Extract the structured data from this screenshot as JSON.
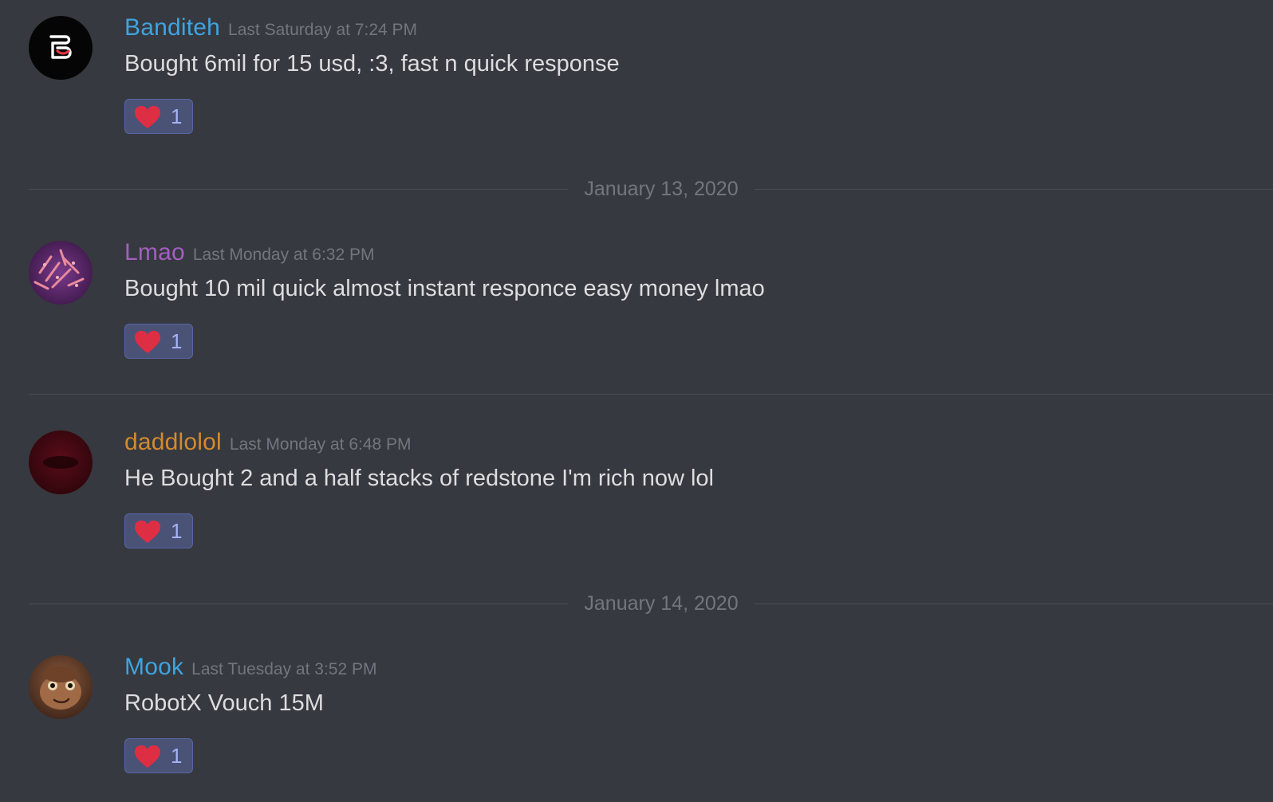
{
  "messages": [
    {
      "username": "Banditeh",
      "username_color": "#3ea4e0",
      "timestamp": "Last Saturday at 7:24 PM",
      "content": "Bought 6mil for 15 usd, :3, fast n quick response",
      "reaction": {
        "emoji": "heart-icon",
        "count": "1"
      }
    },
    {
      "username": "Lmao",
      "username_color": "#a45fc0",
      "timestamp": "Last Monday at 6:32 PM",
      "content": "Bought 10 mil quick almost instant responce easy money lmao",
      "reaction": {
        "emoji": "heart-icon",
        "count": "1"
      }
    },
    {
      "username": "daddlolol",
      "username_color": "#d48a2f",
      "timestamp": "Last Monday at 6:48 PM",
      "content": "He Bought 2 and a half stacks of redstone I'm rich now lol",
      "reaction": {
        "emoji": "heart-icon",
        "count": "1"
      }
    },
    {
      "username": "Mook",
      "username_color": "#3ea4e0",
      "timestamp": "Last Tuesday at 3:52 PM",
      "content": "RobotX Vouch 15M",
      "reaction": {
        "emoji": "heart-icon",
        "count": "1"
      }
    }
  ],
  "date_dividers": [
    {
      "label": "January 13, 2020"
    },
    {
      "label": "January 14, 2020"
    }
  ],
  "colors": {
    "background": "#36393f",
    "reaction_bg": "#4a5276",
    "reaction_count": "#a5b2f5",
    "heart": "#dd2e44",
    "muted": "#72767d"
  }
}
